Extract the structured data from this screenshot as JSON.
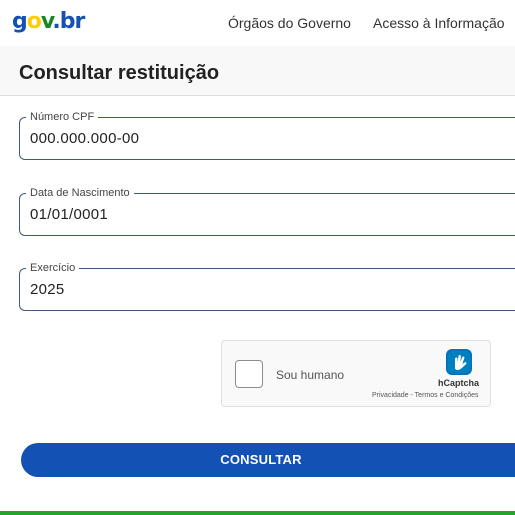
{
  "header": {
    "logo": {
      "g": "g",
      "o": "o",
      "v": "v",
      "dot": ".",
      "b": "b",
      "r": "r"
    },
    "nav": [
      "Órgãos do Governo",
      "Acesso à Informação"
    ]
  },
  "page": {
    "title": "Consultar restituição"
  },
  "form": {
    "cpf": {
      "label": "Número CPF",
      "value": "000.000.000-00"
    },
    "birth_date": {
      "label": "Data de Nascimento",
      "value": "01/01/0001"
    },
    "exercise": {
      "label": "Exercício",
      "value": "2025"
    }
  },
  "captcha": {
    "label": "Sou humano",
    "brand": "hCaptcha",
    "links": "Privacidade - Termos e Condições",
    "checked": false
  },
  "submit": {
    "label": "CONSULTAR"
  },
  "colors": {
    "primary": "#1351b4",
    "logo_yellow": "#ffcd07",
    "logo_green": "#168821",
    "footer_green": "#22a52a",
    "field_border": "#3c5a82"
  }
}
